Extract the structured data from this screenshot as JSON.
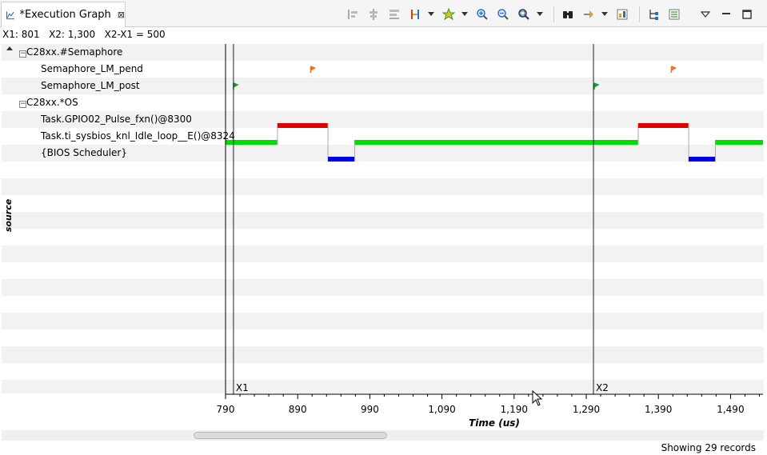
{
  "tab": {
    "title": "*Execution Graph",
    "close_glyph": "⊠"
  },
  "toolbar": {
    "icons": [
      "align-left-icon",
      "align-center-icon",
      "align-group-icon",
      "measure-icon",
      "pin-icon",
      "zoom-in-icon",
      "zoom-out-icon",
      "zoom-fit-icon",
      "find-icon",
      "goto-icon",
      "properties-icon",
      "tree-icon",
      "list-icon",
      "view-menu-icon",
      "minimize-icon",
      "maximize-icon"
    ]
  },
  "cursor_info": {
    "x1": "X1: 801",
    "x2": "X2: 1,300",
    "delta": "X2-X1 = 500"
  },
  "side_label": "source",
  "rows": [
    {
      "label": "C28xx.#Semaphore",
      "group": true
    },
    {
      "label": "Semaphore_LM_pend",
      "group": false
    },
    {
      "label": "Semaphore_LM_post",
      "group": false
    },
    {
      "label": "C28xx.*OS",
      "group": true
    },
    {
      "label": "Task.GPIO02_Pulse_fxn()@8300",
      "group": false
    },
    {
      "label": "Task.ti_sysbios_knl_Idle_loop__E()@8324",
      "group": false
    },
    {
      "label": "{BIOS Scheduler}",
      "group": false
    }
  ],
  "chart_data": {
    "type": "gantt",
    "xlabel": "Time  (us)",
    "xlim": [
      790,
      1535
    ],
    "ticks": [
      790,
      890,
      990,
      1090,
      1190,
      1290,
      1390,
      1490
    ],
    "tick_labels": [
      "790",
      "890",
      "990",
      "1,090",
      "1,190",
      "1,290",
      "1,390",
      "1,490"
    ],
    "markers": [
      {
        "label": "X1",
        "x": 801
      },
      {
        "label": "X2",
        "x": 1300
      }
    ],
    "extra_lines": [
      790
    ],
    "colors": {
      "GPIO02_Pulse": "#e00000",
      "Idle": "#00dd00",
      "Scheduler": "#0000e6",
      "pend": "#f07020",
      "post": "#10a030"
    },
    "task_segments": [
      {
        "row": 5,
        "start": 790,
        "end": 862,
        "color": "#00dd00"
      },
      {
        "row": 4,
        "start": 862,
        "end": 932,
        "color": "#e00000"
      },
      {
        "row": 6,
        "start": 932,
        "end": 969,
        "color": "#0000e6"
      },
      {
        "row": 5,
        "start": 969,
        "end": 1362,
        "color": "#00dd00"
      },
      {
        "row": 4,
        "start": 1362,
        "end": 1432,
        "color": "#e00000"
      },
      {
        "row": 6,
        "start": 1432,
        "end": 1469,
        "color": "#0000e6"
      },
      {
        "row": 5,
        "start": 1469,
        "end": 1535,
        "color": "#00dd00"
      }
    ],
    "events": [
      {
        "row": 1,
        "x": 908,
        "color": "#f07020"
      },
      {
        "row": 2,
        "x": 801,
        "color": "#10a030"
      },
      {
        "row": 1,
        "x": 1408,
        "color": "#f07020"
      },
      {
        "row": 2,
        "x": 1301,
        "color": "#10a030"
      }
    ]
  },
  "status": "Showing 29 records"
}
